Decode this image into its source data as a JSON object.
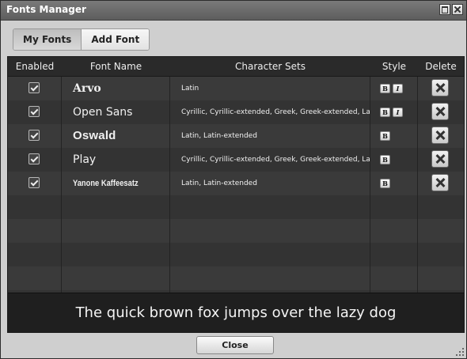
{
  "window": {
    "title": "Fonts Manager"
  },
  "tabs": [
    {
      "label": "My Fonts",
      "active": true
    },
    {
      "label": "Add Font",
      "active": false
    }
  ],
  "table": {
    "headers": {
      "enabled": "Enabled",
      "font_name": "Font Name",
      "character_sets": "Character Sets",
      "style": "Style",
      "delete": "Delete"
    },
    "rows": [
      {
        "enabled": true,
        "font_name": "Arvo",
        "character_sets": "Latin",
        "styles": [
          "B",
          "I"
        ]
      },
      {
        "enabled": true,
        "font_name": "Open Sans",
        "character_sets": "Cyrillic, Cyrillic-extended, Greek, Greek-extended, Latin, L",
        "styles": [
          "B",
          "I"
        ]
      },
      {
        "enabled": true,
        "font_name": "Oswald",
        "character_sets": "Latin, Latin-extended",
        "styles": [
          "B"
        ]
      },
      {
        "enabled": true,
        "font_name": "Play",
        "character_sets": "Cyrillic, Cyrillic-extended, Greek, Greek-extended, Latin, L",
        "styles": [
          "B"
        ]
      },
      {
        "enabled": true,
        "font_name": "Yanone Kaffeesatz",
        "character_sets": "Latin, Latin-extended",
        "styles": [
          "B"
        ]
      }
    ]
  },
  "preview": {
    "text": "The quick brown fox jumps over the lazy dog"
  },
  "footer": {
    "close_label": "Close"
  },
  "colors": {
    "titlebar": "#6b6b6b",
    "grid_background": "#2c2c2c",
    "row_odd": "#3a3a3a",
    "row_even": "#333333",
    "text": "#f0f0f0"
  },
  "icons": {
    "maximize": "maximize-icon",
    "close": "close-icon",
    "delete": "delete-x-icon",
    "checkbox": "checkbox-checked-icon",
    "resize": "resize-grip-icon"
  }
}
